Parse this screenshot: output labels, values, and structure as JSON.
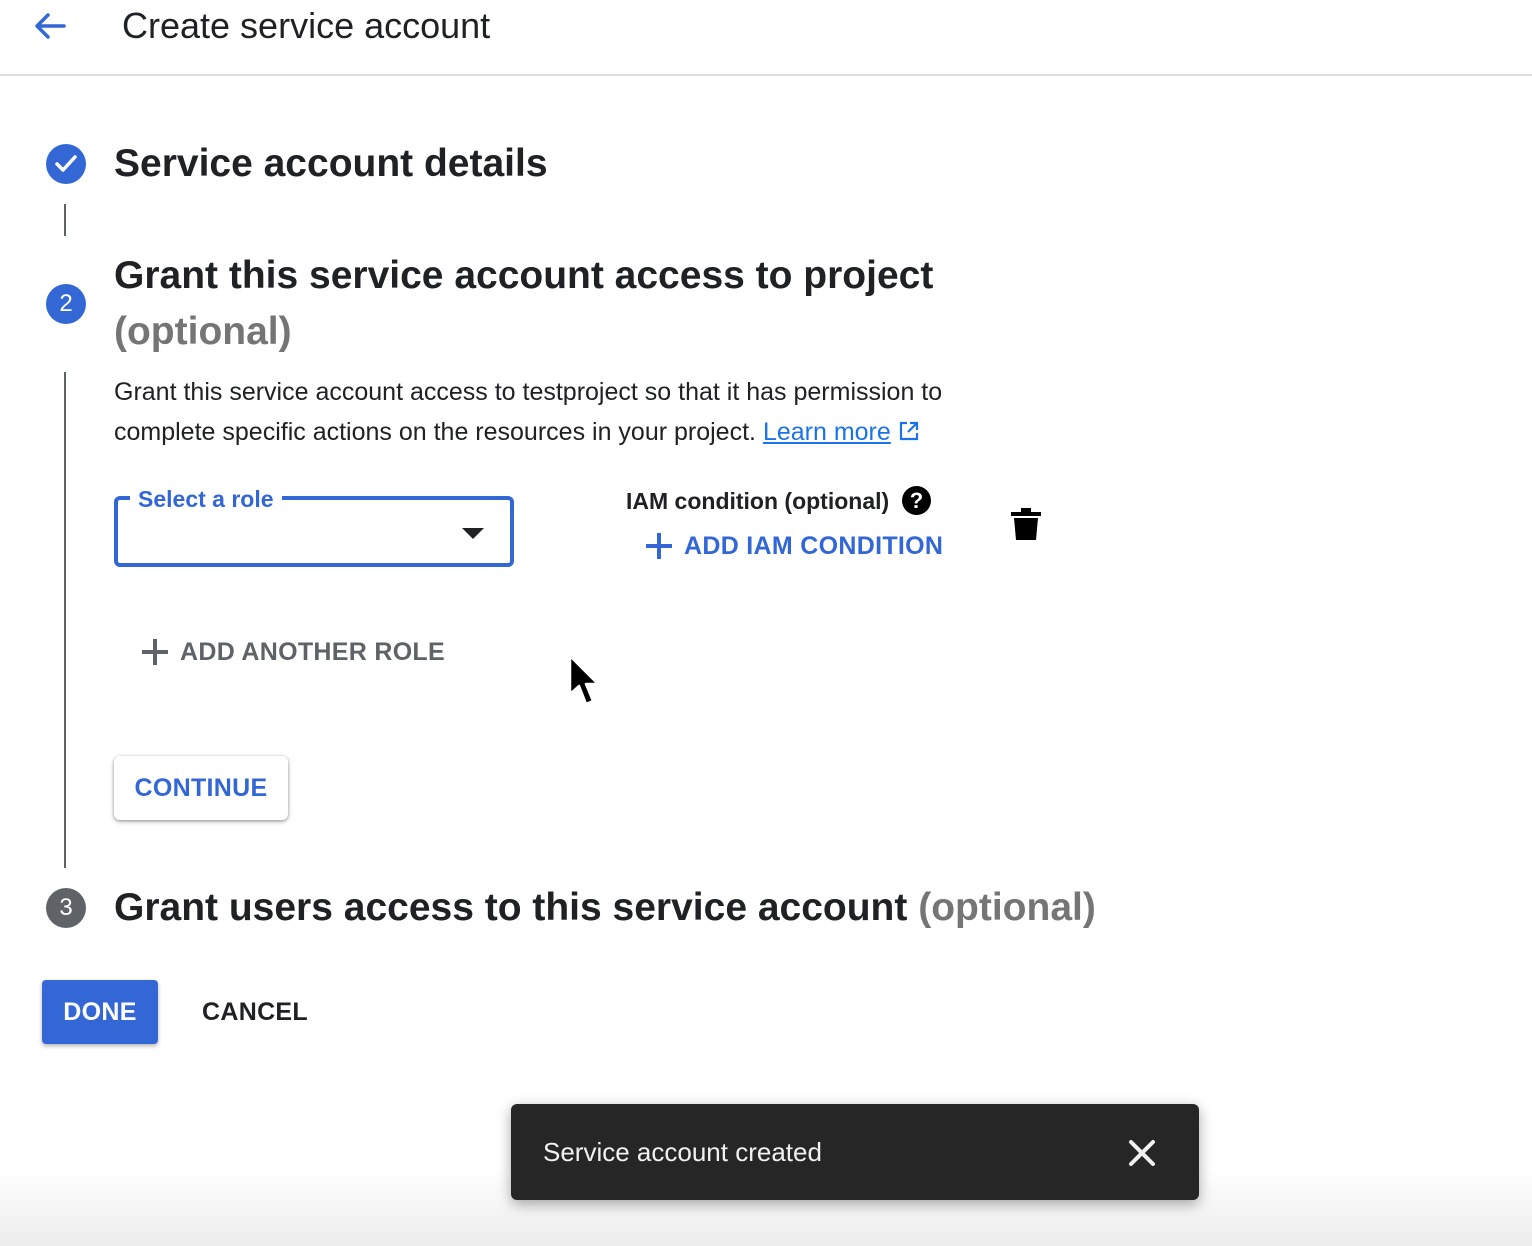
{
  "header": {
    "title": "Create service account",
    "back_icon": "arrow-back-icon"
  },
  "steps": [
    {
      "number": "",
      "state": "completed",
      "title": "Service account details",
      "optional_suffix": ""
    },
    {
      "number": "2",
      "state": "active",
      "title": "Grant this service account access to project",
      "optional_suffix": "(optional)",
      "description": "Grant this service account access to testproject so that it has permission to complete specific actions on the resources in your project.",
      "learn_more_label": "Learn more",
      "role_select_label": "Select a role",
      "role_select_value": "",
      "iam_condition_label": "IAM condition (optional)",
      "add_iam_condition_label": "ADD IAM CONDITION",
      "add_another_role_label": "ADD ANOTHER ROLE",
      "continue_label": "CONTINUE"
    },
    {
      "number": "3",
      "state": "pending",
      "title": "Grant users access to this service account",
      "optional_suffix": "(optional)"
    }
  ],
  "footer": {
    "done_label": "DONE",
    "cancel_label": "CANCEL"
  },
  "snackbar": {
    "message": "Service account created",
    "close_icon": "close-icon"
  },
  "colors": {
    "primary": "#3367d6",
    "text": "#202124",
    "muted": "#757575",
    "snackbar_bg": "#262626"
  }
}
